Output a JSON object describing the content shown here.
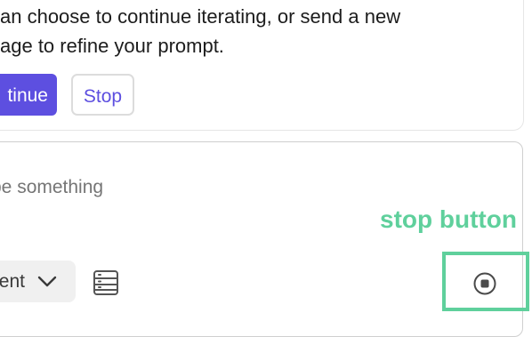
{
  "message": {
    "text": "can choose to continue iterating, or send a new\nsage to refine your prompt.",
    "continue_label": "tinue",
    "stop_label": "Stop"
  },
  "composer": {
    "placeholder": "be something",
    "mode_label": "ent",
    "mode_icon": "chevron-down-icon",
    "table_icon": "table-icon",
    "stop_icon": "stop-circle-icon"
  },
  "annotation": {
    "label": "stop button",
    "color": "#5fd09c"
  },
  "colors": {
    "accent": "#5d4fe0",
    "annotation": "#5fd09c",
    "placeholder": "#a6a6a6"
  }
}
